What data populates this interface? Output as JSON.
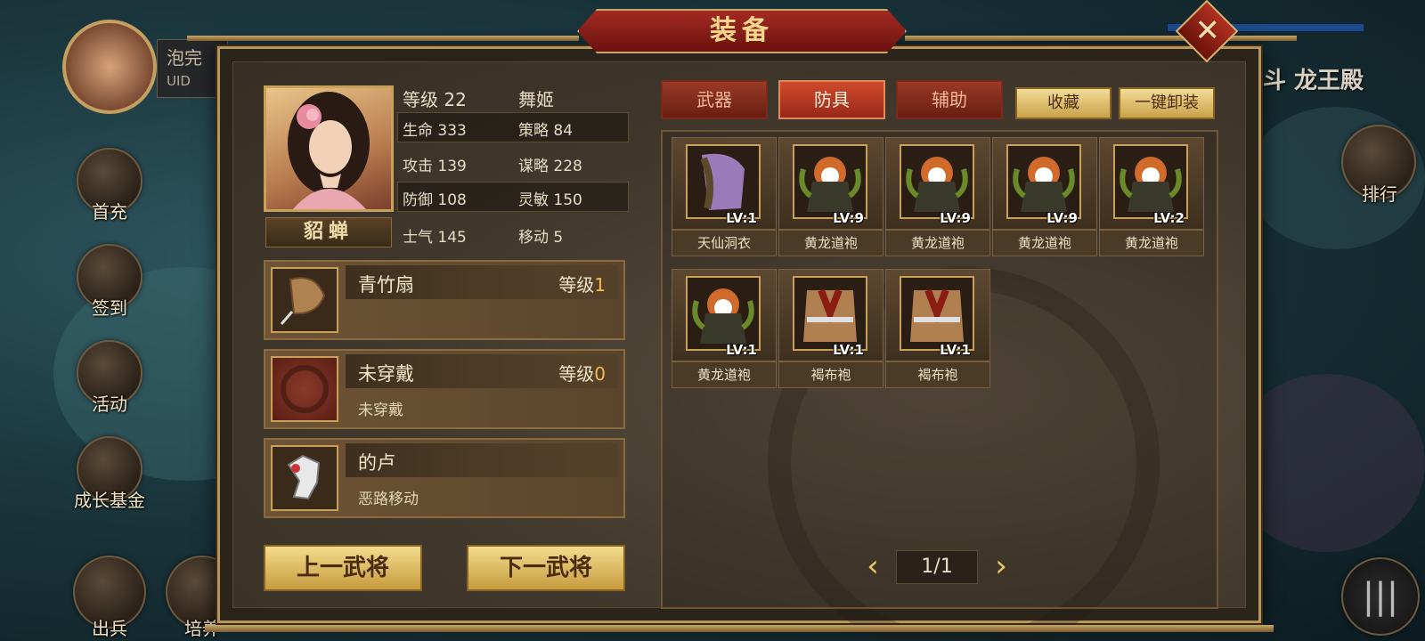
{
  "top_left": {
    "player_name": "泡完",
    "uid_label": "UID"
  },
  "background_text": {
    "map_name": "乱斗 龙王殿"
  },
  "side_menu_left": [
    {
      "label": "首充",
      "icon": "gift-icon"
    },
    {
      "label": "签到",
      "icon": "sign-in-icon"
    },
    {
      "label": "活动",
      "icon": "event-icon"
    },
    {
      "label": "成长基金",
      "icon": "fund-icon"
    },
    {
      "label": "出兵",
      "icon": "deploy-icon"
    },
    {
      "label": "培养",
      "icon": "train-icon"
    }
  ],
  "side_menu_right": [
    {
      "label": "排行",
      "icon": "ranking-icon"
    }
  ],
  "dialog": {
    "title": "装备",
    "close_label": "✕"
  },
  "hero": {
    "name": "貂蝉",
    "level_label": "等级",
    "level": "22",
    "job": "舞姬",
    "stats": [
      {
        "label": "生命",
        "value": "333"
      },
      {
        "label": "策略",
        "value": "84"
      },
      {
        "label": "攻击",
        "value": "139"
      },
      {
        "label": "谋略",
        "value": "228"
      },
      {
        "label": "防御",
        "value": "108"
      },
      {
        "label": "灵敏",
        "value": "150"
      },
      {
        "label": "士气",
        "value": "145"
      },
      {
        "label": "移动",
        "value": "5"
      }
    ]
  },
  "equipped": [
    {
      "name": "青竹扇",
      "level_label": "等级",
      "level": "1",
      "desc": ""
    },
    {
      "name": "未穿戴",
      "level_label": "等级",
      "level": "0",
      "desc": "未穿戴"
    },
    {
      "name": "的卢",
      "level_label": "",
      "level": "",
      "desc": "恶路移动"
    }
  ],
  "nav_buttons": {
    "prev": "上一武将",
    "next": "下一武将"
  },
  "tabs": [
    {
      "label": "武器",
      "active": false
    },
    {
      "label": "防具",
      "active": true
    },
    {
      "label": "辅助",
      "active": false
    }
  ],
  "actions": {
    "favorite": "收藏",
    "unequip_all": "一键卸装"
  },
  "items": [
    {
      "name": "天仙洞衣",
      "lv": "LV:1",
      "kind": "robe-purple"
    },
    {
      "name": "黄龙道袍",
      "lv": "LV:9",
      "kind": "armor-dragon"
    },
    {
      "name": "黄龙道袍",
      "lv": "LV:9",
      "kind": "armor-dragon"
    },
    {
      "name": "黄龙道袍",
      "lv": "LV:9",
      "kind": "armor-dragon"
    },
    {
      "name": "黄龙道袍",
      "lv": "LV:2",
      "kind": "armor-dragon"
    },
    {
      "name": "黄龙道袍",
      "lv": "LV:1",
      "kind": "armor-dragon"
    },
    {
      "name": "褐布袍",
      "lv": "LV:1",
      "kind": "robe-brown"
    },
    {
      "name": "褐布袍",
      "lv": "LV:1",
      "kind": "robe-brown"
    }
  ],
  "pager": {
    "text": "1/1",
    "prev": "‹",
    "next": "›"
  },
  "colors": {
    "accent_gold": "#c9a05a",
    "tab_red": "#98281a",
    "level_orange": "#f7b84a"
  }
}
